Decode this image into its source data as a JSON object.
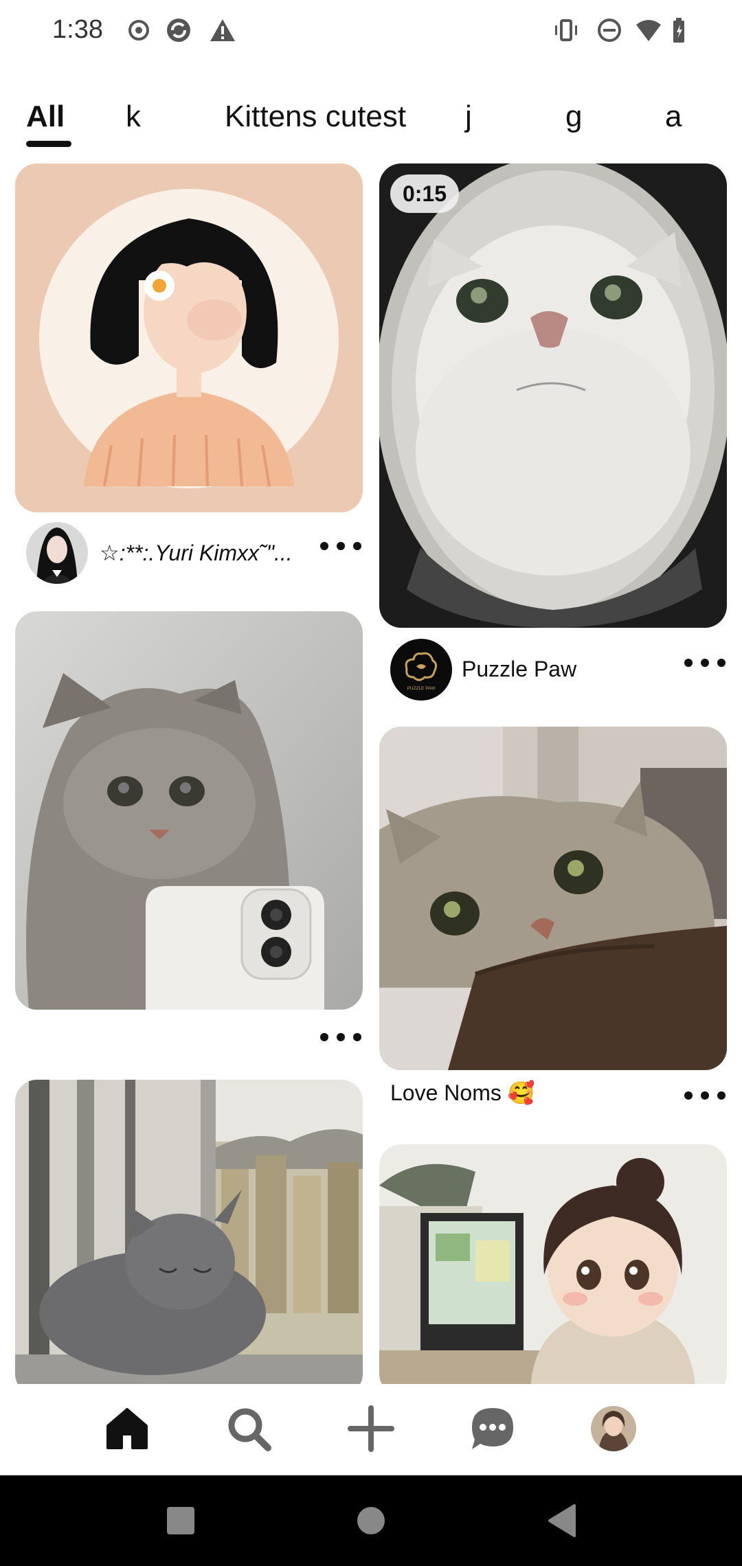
{
  "status_bar": {
    "time": "1:38",
    "icons": [
      "record-icon",
      "sync-icon",
      "alert-icon",
      "vibrate-icon",
      "dnd-icon",
      "wifi-icon",
      "battery-icon"
    ]
  },
  "tabs": [
    {
      "label": "All",
      "selected": true
    },
    {
      "label": "k",
      "selected": false
    },
    {
      "label": "Kittens cutest",
      "selected": false
    },
    {
      "label": "j",
      "selected": false
    },
    {
      "label": "g",
      "selected": false
    },
    {
      "label": "a",
      "selected": false
    }
  ],
  "pins": {
    "girl_illustration": {
      "author": "☆:**:.Yuri Kimxx˜\"..."
    },
    "fisheye_cat": {
      "duration": "0:15",
      "author": "Puzzle Paw",
      "avatar_text": "PUZZLE PAW"
    },
    "phone_cat": {},
    "biting_cat": {
      "title": "Love Noms 🥰"
    },
    "window_kitten": {},
    "computer_girl": {}
  },
  "bottom_nav": [
    "home-icon",
    "search-icon",
    "create-icon",
    "messages-icon",
    "profile-icon"
  ],
  "system_nav": [
    "recents-button",
    "home-button",
    "back-button"
  ],
  "colors": {
    "text": "#111111",
    "background": "#ffffff",
    "system_bar": "#000000"
  }
}
